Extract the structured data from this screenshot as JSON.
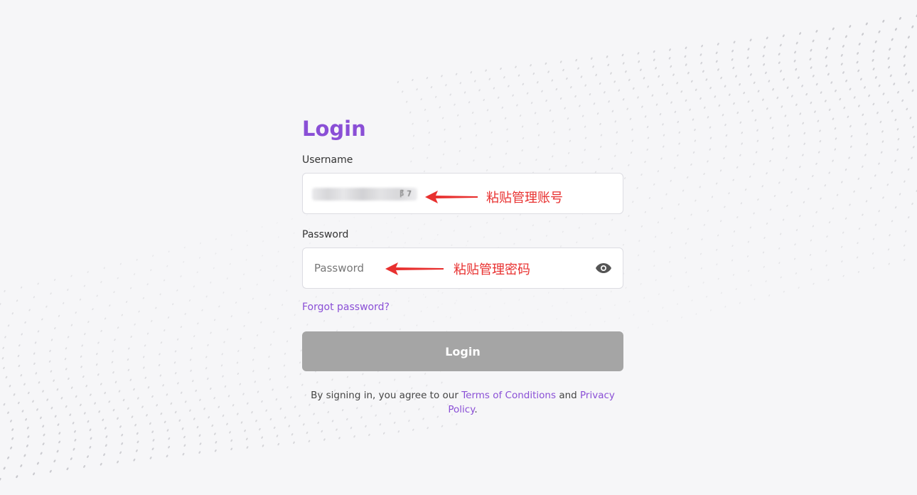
{
  "title": "Login",
  "username": {
    "label": "Username",
    "value": "（已模糊处理）",
    "annotation": "粘贴管理账号"
  },
  "password": {
    "label": "Password",
    "placeholder": "Password",
    "annotation": "粘贴管理密码",
    "toggle_icon": "eye-icon"
  },
  "forgot_password": "Forgot password?",
  "login_button": "Login",
  "terms": {
    "prefix": "By signing in, you agree to our",
    "terms_link": "Terms of Conditions",
    "and": "and",
    "privacy_link": "Privacy Policy",
    "suffix": "."
  },
  "colors": {
    "accent": "#8a4fd6",
    "button_disabled": "#a5a5a5",
    "annotation": "#e8302f",
    "background": "#f6f6f8"
  }
}
